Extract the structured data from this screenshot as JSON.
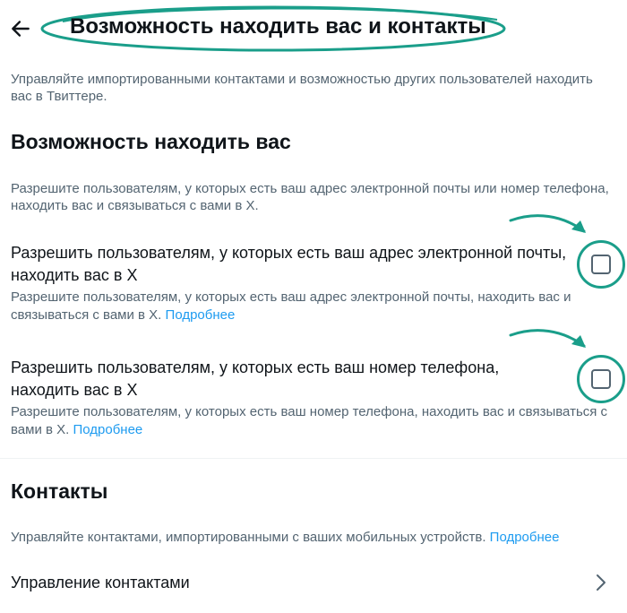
{
  "header": {
    "title": "Возможность находить вас и контакты",
    "back_icon": "arrow-left-icon"
  },
  "intro_text": "Управляйте импортированными контактами и возможностью других пользователей находить вас в Твиттере.",
  "discoverability": {
    "heading": "Возможность находить вас",
    "description": "Разрешите пользователям, у которых есть ваш адрес электронной почты или номер телефона, находить вас и связываться с вами в X.",
    "options": [
      {
        "title": "Разрешить пользователям, у которых есть ваш адрес электронной почты, находить вас в X",
        "description": "Разрешите пользователям, у которых есть ваш адрес электронной почты, находить вас и связываться с вами в X.",
        "link": "Подробнее",
        "checked": false
      },
      {
        "title": "Разрешить пользователям, у которых есть ваш номер телефона, находить вас в X",
        "description": "Разрешите пользователям, у которых есть ваш номер телефона, находить вас и связываться с вами в X.",
        "link": "Подробнее",
        "checked": false
      }
    ]
  },
  "contacts": {
    "heading": "Контакты",
    "description": "Управляйте контактами, импортированными с ваших мобильных устройств.",
    "link": "Подробнее",
    "manage_label": "Управление контактами",
    "chevron_icon": "chevron-right-icon"
  },
  "colors": {
    "annotation": "#1a9e8a",
    "link": "#1d9bf0",
    "secondary_text": "#536471",
    "primary_text": "#0f1419"
  }
}
